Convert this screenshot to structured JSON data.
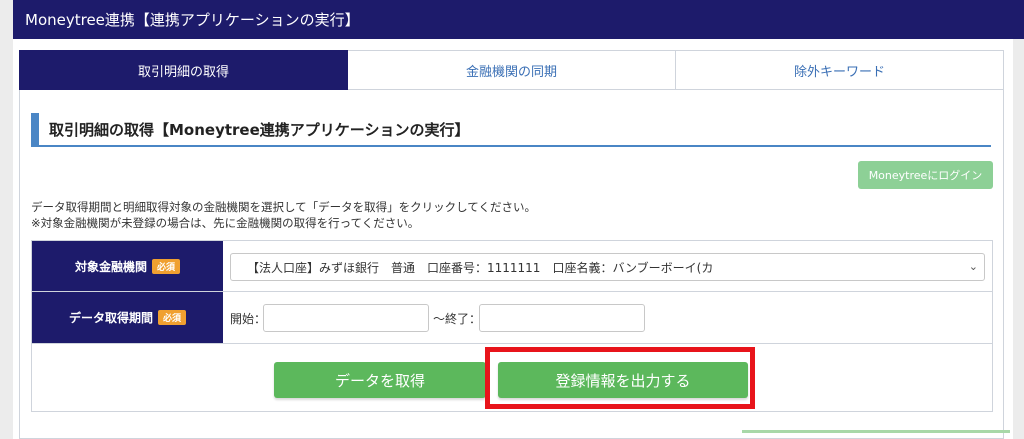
{
  "header": {
    "title": "Moneytree連携【連携アプリケーションの実行】"
  },
  "tabs": [
    {
      "label": "取引明細の取得",
      "active": true
    },
    {
      "label": "金融機関の同期",
      "active": false
    },
    {
      "label": "除外キーワード",
      "active": false
    }
  ],
  "section": {
    "title": "取引明細の取得【Moneytree連携アプリケーションの実行】"
  },
  "login_button": "Moneytreeにログイン",
  "description": {
    "line1": "データ取得期間と明細取得対象の金融機関を選択して「データを取得」をクリックしてください。",
    "line2": "※対象金融機関が未登録の場合は、先に金融機関の取得を行ってください。"
  },
  "form": {
    "institution": {
      "label": "対象金融機関",
      "required": "必須",
      "selected": "【法人口座】みずほ銀行　普通　口座番号：1111111　口座名義：バンブーボーイ(カ"
    },
    "period": {
      "label": "データ取得期間",
      "required": "必須",
      "start_label": "開始：",
      "end_label": "～終了：",
      "start_value": "",
      "end_value": ""
    }
  },
  "buttons": {
    "fetch": "データを取得",
    "export": "登録情報を出力する"
  },
  "colors": {
    "navy": "#1d1b6b",
    "accent_blue": "#4a86c5",
    "green": "#5cb85c",
    "badge_orange": "#f0a030",
    "highlight_red": "#e8141b"
  }
}
